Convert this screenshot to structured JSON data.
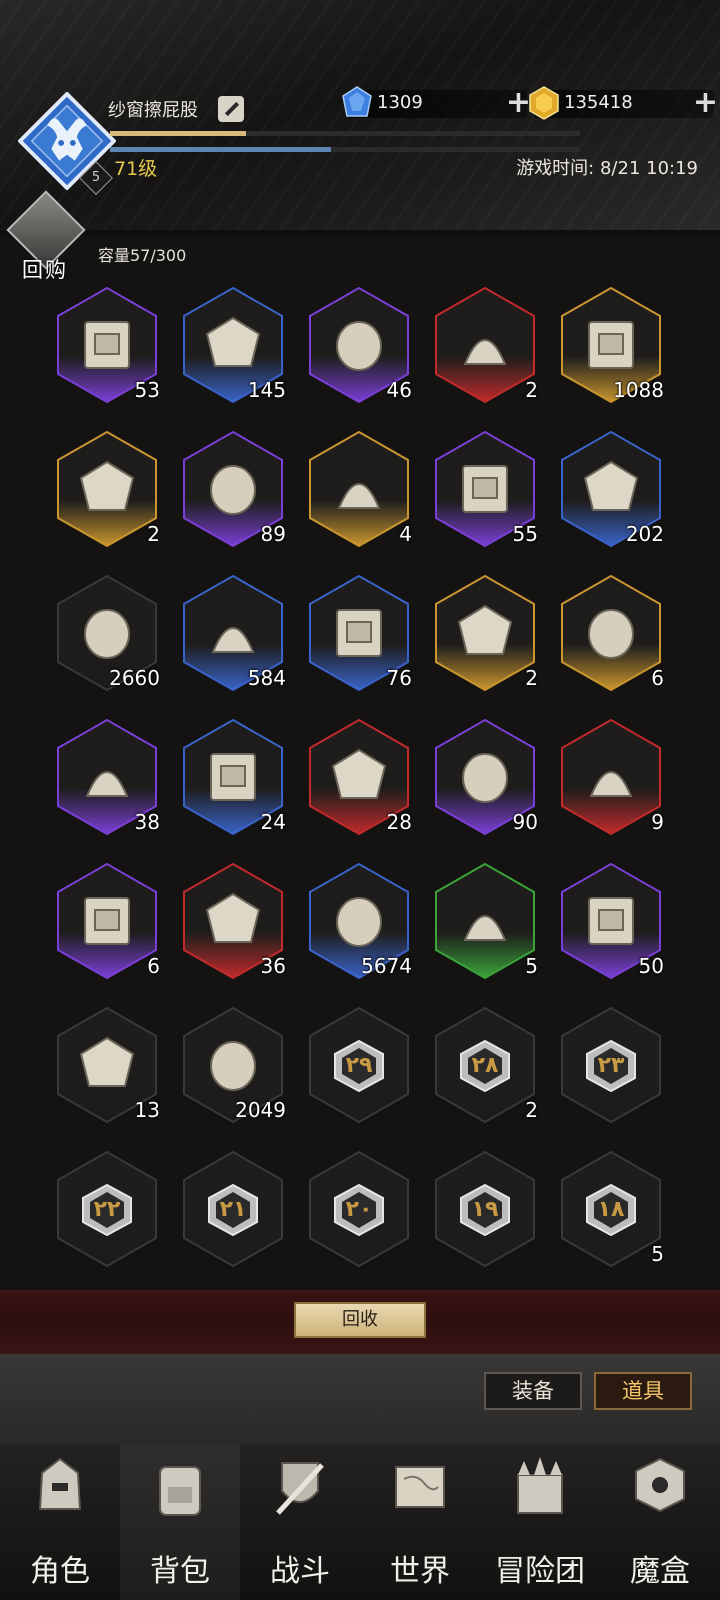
{
  "player": {
    "name": "纱窗擦屁股",
    "level_label": "71级",
    "rank_badge": "5",
    "exp_progress": 0.29,
    "secondary_progress": 0.47
  },
  "currency": {
    "gems": "1309",
    "gold": "135418",
    "plus": "+"
  },
  "game_time": "游戏时间: 8/21 10:19",
  "bag": {
    "recycle_shop_label": "回购",
    "capacity_label": "容量57/300"
  },
  "items": [
    {
      "name": "treasure-map-scroll-icon",
      "count": "53",
      "rarity": "purple"
    },
    {
      "name": "chest-map-scroll-icon",
      "count": "145",
      "rarity": "blue"
    },
    {
      "name": "hourglass-icon",
      "count": "46",
      "rarity": "purple"
    },
    {
      "name": "flame-spirit-icon",
      "count": "2",
      "rarity": "red"
    },
    {
      "name": "potion-jar-icon",
      "count": "1088",
      "rarity": "gold"
    },
    {
      "name": "crystal-shard-icon",
      "count": "2",
      "rarity": "gold"
    },
    {
      "name": "crystal-cluster-icon",
      "count": "89",
      "rarity": "purple"
    },
    {
      "name": "rune-stone-icon",
      "count": "4",
      "rarity": "gold"
    },
    {
      "name": "sealed-scroll-icon",
      "count": "55",
      "rarity": "purple"
    },
    {
      "name": "rolled-scroll-icon",
      "count": "202",
      "rarity": "blue"
    },
    {
      "name": "cloth-scrap-icon",
      "count": "2660",
      "rarity": "none"
    },
    {
      "name": "torch-icon",
      "count": "584",
      "rarity": "blue"
    },
    {
      "name": "pocket-watch-icon",
      "count": "76",
      "rarity": "blue"
    },
    {
      "name": "mask-icon",
      "count": "2",
      "rarity": "gold"
    },
    {
      "name": "rune-tablet-gold-icon",
      "count": "6",
      "rarity": "gold"
    },
    {
      "name": "rune-tablet-purple-icon",
      "count": "38",
      "rarity": "purple"
    },
    {
      "name": "rune-tablet-blue-icon",
      "count": "24",
      "rarity": "blue"
    },
    {
      "name": "rune-slab-icon",
      "count": "28",
      "rarity": "red"
    },
    {
      "name": "gem-stone-icon",
      "count": "90",
      "rarity": "purple"
    },
    {
      "name": "meteorite-icon",
      "count": "9",
      "rarity": "red"
    },
    {
      "name": "sand-pile-icon",
      "count": "6",
      "rarity": "purple"
    },
    {
      "name": "torn-banner-icon",
      "count": "36",
      "rarity": "red"
    },
    {
      "name": "compass-medallion-icon",
      "count": "5674",
      "rarity": "blue"
    },
    {
      "name": "wrapped-bone-icon",
      "count": "5",
      "rarity": "green"
    },
    {
      "name": "void-cube-icon",
      "count": "50",
      "rarity": "purple"
    },
    {
      "name": "stone-fragment-icon",
      "count": "13",
      "rarity": "none"
    },
    {
      "name": "large-crystal-icon",
      "count": "2049",
      "rarity": "none"
    },
    {
      "name": "rune-token-icon",
      "count": "",
      "rarity": "none",
      "rune": "٢٩"
    },
    {
      "name": "rune-token-icon",
      "count": "2",
      "rarity": "none",
      "rune": "٢٨"
    },
    {
      "name": "rune-token-icon",
      "count": "",
      "rarity": "none",
      "rune": "٢٣"
    },
    {
      "name": "rune-token-icon",
      "count": "",
      "rarity": "none",
      "rune": "٢٢"
    },
    {
      "name": "rune-token-icon",
      "count": "",
      "rarity": "none",
      "rune": "٢١"
    },
    {
      "name": "rune-token-icon",
      "count": "",
      "rarity": "none",
      "rune": "٢٠"
    },
    {
      "name": "rune-token-icon",
      "count": "",
      "rarity": "none",
      "rune": "١٩"
    },
    {
      "name": "rune-token-icon",
      "count": "5",
      "rarity": "none",
      "rune": "١٨"
    }
  ],
  "actions": {
    "recycle_label": "回收"
  },
  "tabs": {
    "equip_label": "装备",
    "items_label": "道具"
  },
  "nav": [
    {
      "label": "角色",
      "icon": "helmet-icon"
    },
    {
      "label": "背包",
      "icon": "backpack-icon"
    },
    {
      "label": "战斗",
      "icon": "sword-shield-icon"
    },
    {
      "label": "世界",
      "icon": "world-map-icon"
    },
    {
      "label": "冒险团",
      "icon": "castle-icon"
    },
    {
      "label": "魔盒",
      "icon": "magic-box-icon"
    }
  ],
  "colors": {
    "purple": "#7a3fd6",
    "blue": "#3a63c9",
    "red": "#c02b2b",
    "gold": "#c9962f",
    "green": "#3aa33a",
    "none": "#3a3938",
    "level_text": "#e7c94b",
    "active_tab_text": "#f2c56a"
  }
}
